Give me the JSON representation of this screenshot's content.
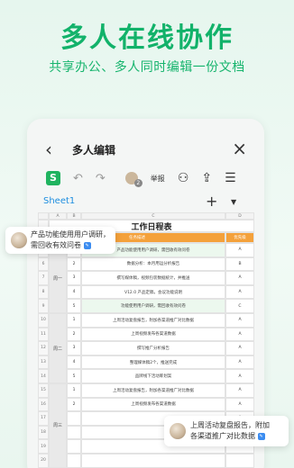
{
  "headline": "多人在线协作",
  "subline": "共享办公、多人同时编辑一份文档",
  "app": {
    "title": "多人编辑",
    "back_icon": "chevron-left-icon",
    "close_icon": "close-icon",
    "logo_letter": "S",
    "collaborator_count": "2",
    "report_label": "举报",
    "sheet_tab": "Sheet1"
  },
  "sheet": {
    "columns": [
      "A",
      "B",
      "C",
      "D"
    ],
    "title": "工作日程表",
    "header_task": "任务描述",
    "header_priority": "优先级",
    "weeks": [
      "周一",
      "周二",
      "周三"
    ],
    "rows": [
      {
        "r": "5",
        "n": "1",
        "task": "产品功能使用用户调研，需回收有效问卷",
        "p": "A"
      },
      {
        "r": "6",
        "n": "2",
        "task": "数据分析：本月用运分析报告",
        "p": "B"
      },
      {
        "r": "7",
        "n": "3",
        "task": "撰写媒体稿，视频包装数据统计，并推送",
        "p": "A"
      },
      {
        "r": "8",
        "n": "4",
        "task": "V12.0 产品定稿，会议功能说明",
        "p": "A"
      },
      {
        "r": "9",
        "n": "5",
        "task": "功能使用用户调研，需回收有效问卷",
        "p": "C"
      },
      {
        "r": "10",
        "n": "1",
        "task": "上周活动复盘报告，附加各渠道推广对比数据",
        "p": "A"
      },
      {
        "r": "11",
        "n": "2",
        "task": "上周视频发布各渠道数据",
        "p": "A"
      },
      {
        "r": "12",
        "n": "3",
        "task": "撰写推广分析报告",
        "p": "A"
      },
      {
        "r": "13",
        "n": "4",
        "task": "整理媒体稿2个，推送完成",
        "p": "A"
      },
      {
        "r": "14",
        "n": "5",
        "task": "品牌线下活动筹划案",
        "p": "A"
      },
      {
        "r": "15",
        "n": "1",
        "task": "上周活动复盘报告，附加各渠道推广对比数据",
        "p": "A"
      },
      {
        "r": "16",
        "n": "2",
        "task": "上周视频发布各渠道数据",
        "p": "A"
      },
      {
        "r": "17",
        "n": "",
        "task": "",
        "p": "A"
      },
      {
        "r": "18",
        "n": "",
        "task": "",
        "p": "A"
      },
      {
        "r": "19",
        "n": "",
        "task": "",
        "p": ""
      },
      {
        "r": "20",
        "n": "",
        "task": "",
        "p": ""
      }
    ]
  },
  "bubble_left": {
    "line1": "产品功能使用用户调研，",
    "line2": "需回收有效问卷"
  },
  "bubble_right": {
    "line1": "上周活动复盘报告，附加",
    "line2": "各渠道推广对比数据"
  },
  "colors": {
    "brand_green": "#12b26a",
    "header_orange": "#f4a13b",
    "tag_blue": "#3b8cf0"
  }
}
